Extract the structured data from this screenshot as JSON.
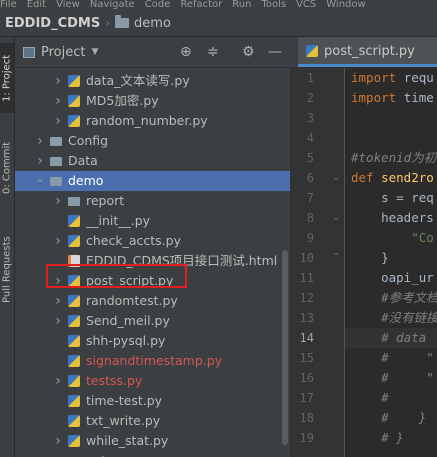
{
  "menubar": {
    "items": [
      "File",
      "Edit",
      "View",
      "Navigate",
      "Code",
      "Refactor",
      "Run",
      "Tools",
      "VCS",
      "Window"
    ]
  },
  "navbar": {
    "root": "EDDID_CDMS",
    "current": "demo"
  },
  "left_strip": {
    "project_tab": "1: Project",
    "commit_tab": "0: Commit",
    "pull_requests_tab": "Pull Requests"
  },
  "project_panel": {
    "title": "Project",
    "tree": [
      {
        "label": "data_文本读写.py",
        "type": "py",
        "level": 3,
        "chevron": "right"
      },
      {
        "label": "MD5加密.py",
        "type": "py",
        "level": 3,
        "chevron": "right"
      },
      {
        "label": "random_number.py",
        "type": "py",
        "level": 3,
        "chevron": "right"
      },
      {
        "label": "Config",
        "type": "folder",
        "level": 2,
        "chevron": "right"
      },
      {
        "label": "Data",
        "type": "folder",
        "level": 2,
        "chevron": "right"
      },
      {
        "label": "demo",
        "type": "folder",
        "level": 2,
        "chevron": "down",
        "selected": true
      },
      {
        "label": "report",
        "type": "folder",
        "level": 3,
        "chevron": "right"
      },
      {
        "label": "__init__.py",
        "type": "py",
        "level": 3,
        "chevron": ""
      },
      {
        "label": "check_accts.py",
        "type": "py",
        "level": 3,
        "chevron": "right"
      },
      {
        "label": "EDDID_CDMS项目接口测试.html",
        "type": "html",
        "level": 3,
        "chevron": ""
      },
      {
        "label": "post_script.py",
        "type": "py",
        "level": 3,
        "chevron": "right",
        "boxed": true
      },
      {
        "label": "randomtest.py",
        "type": "py",
        "level": 3,
        "chevron": "right"
      },
      {
        "label": "Send_meil.py",
        "type": "py",
        "level": 3,
        "chevron": "right"
      },
      {
        "label": "shh-pysql.py",
        "type": "py",
        "level": 3,
        "chevron": ""
      },
      {
        "label": "signandtimestamp.py",
        "type": "py",
        "level": 3,
        "chevron": "",
        "red": true
      },
      {
        "label": "testss.py",
        "type": "py",
        "level": 3,
        "chevron": "right",
        "red": true
      },
      {
        "label": "time-test.py",
        "type": "py",
        "level": 3,
        "chevron": ""
      },
      {
        "label": "txt_write.py",
        "type": "py",
        "level": 3,
        "chevron": ""
      },
      {
        "label": "while_stat.py",
        "type": "py",
        "level": 3,
        "chevron": "right"
      },
      {
        "label": "report",
        "type": "folder",
        "level": 2,
        "chevron": "right"
      }
    ]
  },
  "editor": {
    "tab_label": "post_script.py",
    "current_line": "14",
    "lines": [
      {
        "n": "1",
        "kw": "import ",
        "text": "requ"
      },
      {
        "n": "2",
        "kw": "import ",
        "text": "time"
      },
      {
        "n": "3",
        "kw": "",
        "text": ""
      },
      {
        "n": "4",
        "kw": "",
        "text": ""
      },
      {
        "n": "5",
        "kw": "",
        "comment": "#tokenid为初"
      },
      {
        "n": "6",
        "kw": "def ",
        "fn": "send2ro"
      },
      {
        "n": "7",
        "kw": "",
        "text": "    s = req"
      },
      {
        "n": "8",
        "kw": "",
        "text": "    headers"
      },
      {
        "n": "9",
        "kw": "",
        "str": "        \"Co"
      },
      {
        "n": "10",
        "kw": "",
        "text": "    }"
      },
      {
        "n": "11",
        "kw": "",
        "text": "    oapi_ur"
      },
      {
        "n": "12",
        "kw": "",
        "comment": "    #参考文档"
      },
      {
        "n": "13",
        "kw": "",
        "comment": "    #没有链接"
      },
      {
        "n": "14",
        "kw": "",
        "comment": "    # data"
      },
      {
        "n": "15",
        "kw": "",
        "comment": "    #     \""
      },
      {
        "n": "16",
        "kw": "",
        "comment": "    #     \""
      },
      {
        "n": "17",
        "kw": "",
        "comment": "    #"
      },
      {
        "n": "18",
        "kw": "",
        "comment": "    #    }"
      },
      {
        "n": "19",
        "kw": "",
        "comment": "    # }"
      }
    ]
  },
  "colors": {
    "selection": "#4b6eaf",
    "highlight_box": "#e02020",
    "vcs_untracked": "#d45656",
    "keyword": "#cc7832",
    "comment": "#808080"
  }
}
